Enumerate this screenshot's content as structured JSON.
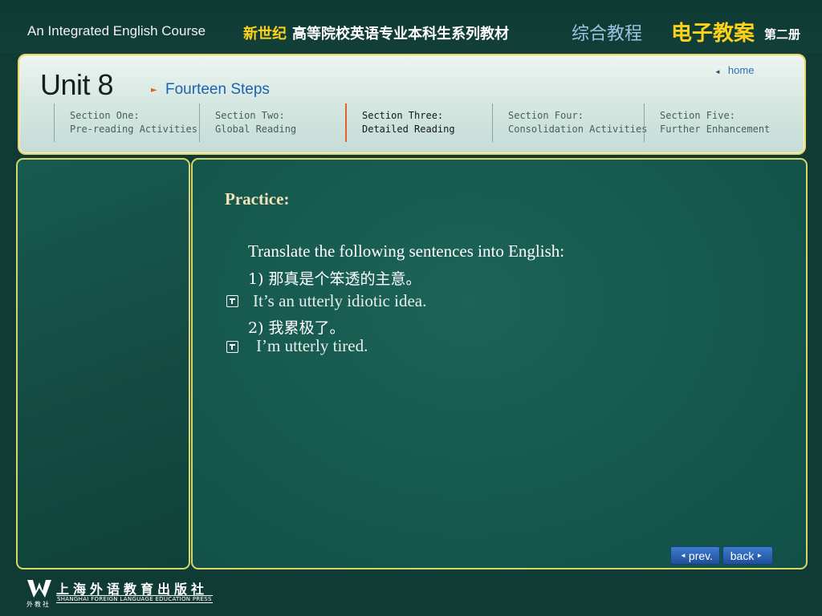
{
  "header": {
    "course_title": "An Integrated English Course",
    "series_cn_highlight": "新世纪",
    "series_cn": "高等院校英语专业本科生系列教材",
    "book_cn": "综合教程",
    "courseware_cn": "电子教案",
    "volume_cn": "第二册"
  },
  "unit": {
    "title": "Unit 8",
    "subtitle": "Fourteen Steps",
    "home_label": "home"
  },
  "sections": [
    {
      "line1": "Section One:",
      "line2": "Pre-reading Activities",
      "active": false
    },
    {
      "line1": "Section Two:",
      "line2": "Global Reading",
      "active": false
    },
    {
      "line1": "Section Three:",
      "line2": "Detailed Reading",
      "active": true
    },
    {
      "line1": "Section Four:",
      "line2": "Consolidation Activities",
      "active": false
    },
    {
      "line1": "Section Five:",
      "line2": "Further Enhancement",
      "active": false
    }
  ],
  "content": {
    "heading": "Practice:",
    "instruction": "Translate the following sentences into English:",
    "items": [
      {
        "prompt": "1) 那真是个笨透的主意。",
        "answer": "It’s an utterly idiotic idea."
      },
      {
        "prompt": "2) 我累极了。",
        "answer": "I’m utterly tired."
      }
    ]
  },
  "nav": {
    "prev_label": "prev.",
    "back_label": "back"
  },
  "footer": {
    "publisher_cn": "上海外语教育出版社",
    "publisher_en": "SHANGHAI FOREIGN LANGUAGE EDUCATION PRESS",
    "publisher_short": "外教社"
  },
  "colors": {
    "background": "#0f3b34",
    "panel_border": "#d8d56a",
    "accent_yellow": "#ffd21a",
    "link_blue": "#1c63b0",
    "active_marker": "#e06030"
  }
}
